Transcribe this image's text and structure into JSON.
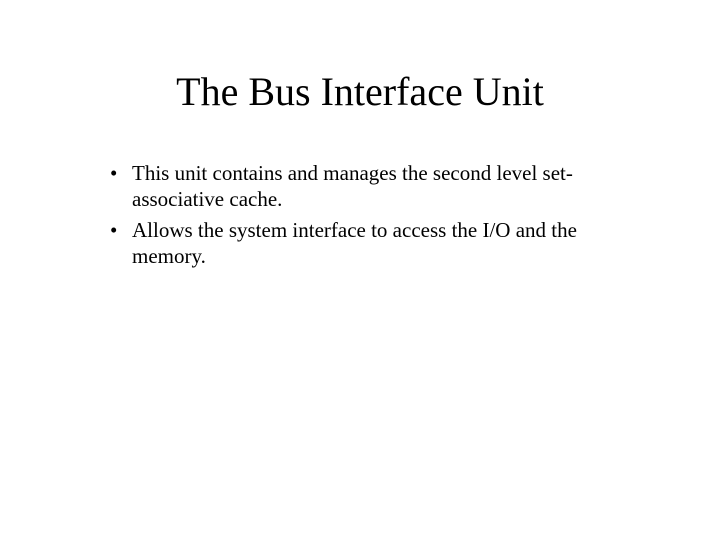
{
  "slide": {
    "title": "The Bus Interface Unit",
    "bullets": [
      "This unit contains and manages the second level set-associative cache.",
      "Allows the system interface to access the I/O and the memory."
    ]
  }
}
